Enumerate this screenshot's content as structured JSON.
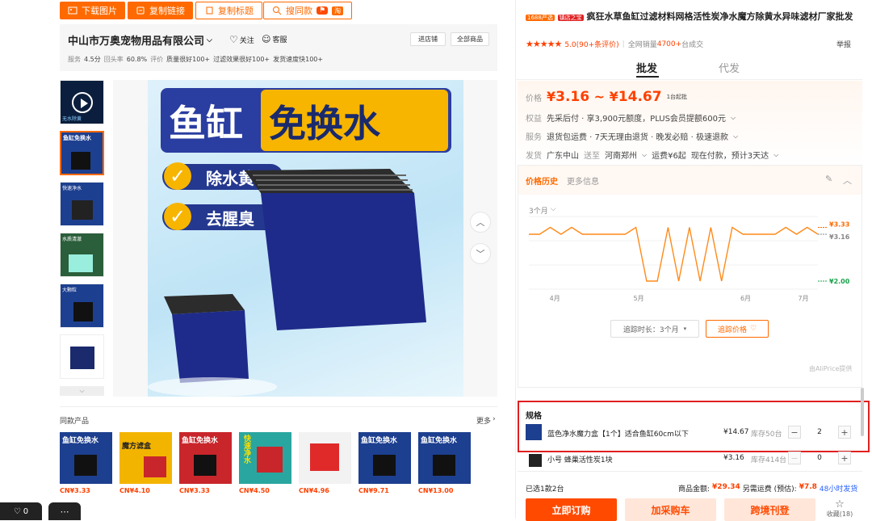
{
  "toolbar": {
    "download": "下载图片",
    "copy_link": "复制链接",
    "copy_title": "复制标题",
    "search_img": "搜同款",
    "badge": "淘"
  },
  "shop": {
    "name": "中山市万奥宠物用品有限公司",
    "follow": "关注",
    "service": "客服",
    "enter_shop": "进店铺",
    "all_products": "全部商品",
    "stats": [
      {
        "label": "服务",
        "value": "4.5分"
      },
      {
        "label": "回头率",
        "value": "60.8%"
      },
      {
        "label": "评价",
        "value": ""
      }
    ],
    "tags": [
      "质量很好100+",
      "过滤效果很好100+",
      "发货速度快100+"
    ]
  },
  "main_image": {
    "line1": "鱼缸",
    "line2": "免换水",
    "check1": "除水黄",
    "check2": "去腥臭"
  },
  "thumbs": [
    {
      "text": "无水除黄"
    },
    {
      "text": "鱼缸免换水"
    },
    {
      "text": "快速净水"
    },
    {
      "text": "水质清澈"
    },
    {
      "text": "大颗粒"
    },
    {
      "text": ""
    }
  ],
  "similar": {
    "title": "同款产品",
    "more": "更多",
    "items": [
      {
        "price": "CN¥3.33",
        "label": "鱼缸免换水",
        "bg": "#1d3f8f"
      },
      {
        "price": "CN¥4.10",
        "label": "魔方滤盒",
        "bg": "#f3b400"
      },
      {
        "price": "CN¥3.33",
        "label": "鱼缸免换水",
        "bg": "#c8262b"
      },
      {
        "price": "CN¥4.50",
        "label": "快速净水",
        "bg": "#2aa6a0"
      },
      {
        "price": "CN¥4.96",
        "label": "",
        "bg": "#f2f2f2"
      },
      {
        "price": "CN¥9.71",
        "label": "鱼缸免换水",
        "bg": "#1d3f8f"
      },
      {
        "price": "CN¥13.00",
        "label": "鱼缸免换水",
        "bg": "#1d3f8f"
      }
    ]
  },
  "product": {
    "tag1": "1688严选",
    "tag2": "镇店之宝",
    "title": "疯狂水草鱼缸过滤材料网格活性炭净水魔方除黄水异味滤材厂家批发",
    "rating": "5.0(90+条评价)",
    "sales_prefix": "全网销量",
    "sales": "4700+",
    "sales_suffix": "台成交",
    "report": "举报"
  },
  "tabs": {
    "wholesale": "批发",
    "dropship": "代发"
  },
  "price": {
    "label": "价格",
    "currency": "¥",
    "low": "3.16",
    "sep": "~",
    "high": "14.67",
    "min_order": "1台起批"
  },
  "rights": {
    "label": "权益",
    "text": "先采后付 · 享3,900元额度，PLUS会员提额600元"
  },
  "service": {
    "label": "服务",
    "text": "退货包运费 · 7天无理由退货 · 晚发必赔 · 极速退款"
  },
  "shipping": {
    "label": "发货",
    "from": "广东中山",
    "to_word": "送至",
    "to": "河南郑州",
    "fee": "运费¥6起",
    "note": "现在付款，预计3天达"
  },
  "history": {
    "tab_active": "价格历史",
    "tab_other": "更多信息",
    "range": "3个月",
    "duration_label": "追踪时长：3个月",
    "track_btn": "追踪价格",
    "provider": "由AliPrice提供"
  },
  "chart_data": {
    "type": "line",
    "x": [
      "4月",
      "5月",
      "6月",
      "7月"
    ],
    "series": [
      {
        "values": [
          3.16,
          3.16,
          3.33,
          3.16,
          3.33,
          3.16,
          3.16,
          3.16,
          3.16,
          3.16,
          3.33,
          2.0,
          2.0,
          3.33,
          2.0,
          3.33,
          2.0,
          3.33,
          2.0,
          3.33,
          3.16,
          3.16,
          3.16,
          3.16,
          3.33,
          3.16,
          3.33,
          3.16
        ]
      }
    ],
    "labels": [
      "¥3.33",
      "¥3.16",
      "¥2.00"
    ],
    "ylim": [
      1.8,
      3.6
    ]
  },
  "spec": {
    "title": "规格",
    "items": [
      {
        "name": "蓝色净水魔力盒【1个】适合鱼缸60cm以下",
        "price": "¥14.67",
        "stock": "库存50台",
        "qty": "2"
      },
      {
        "name": "小号 蜂巢活性炭1块",
        "price": "¥3.16",
        "stock": "库存414台",
        "qty": "0"
      }
    ]
  },
  "summary": {
    "selected": "已选1款2台",
    "goods_label": "商品金额:",
    "goods": "¥29.34",
    "ship_label": "另需运费 (预估):",
    "ship": "¥7.8",
    "ship_note": "48小时发货"
  },
  "actions": {
    "buy": "立即订购",
    "cart": "加采购车",
    "dropship": "跨境刊登",
    "fav": "收藏(18)"
  },
  "bottom": {
    "heart_count": "0"
  },
  "colors": {
    "accent": "#ff6a00",
    "price": "#ff4000",
    "highlight": "#e02020"
  }
}
